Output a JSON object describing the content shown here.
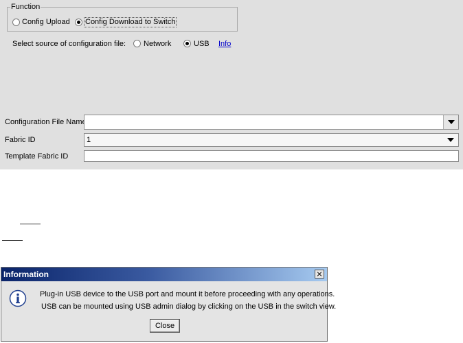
{
  "function_group": {
    "legend": "Function",
    "options": [
      {
        "label": "Config Upload",
        "selected": false
      },
      {
        "label": "Config Download to Switch",
        "selected": true
      }
    ]
  },
  "source": {
    "label": "Select source of configuration file:",
    "options": [
      {
        "label": "Network",
        "selected": false
      },
      {
        "label": "USB",
        "selected": true
      }
    ],
    "info_link": "Info"
  },
  "form": {
    "config_file_name": {
      "label": "Configuration File Name",
      "value": ""
    },
    "fabric_id": {
      "label": "Fabric ID",
      "value": "1"
    },
    "template_fabric_id": {
      "label": "Template Fabric ID",
      "value": ""
    }
  },
  "dialog": {
    "title": "Information",
    "icon": "info-icon",
    "line1": "Plug-in USB device to the USB port and mount it before proceeding with any operations.",
    "line2": "USB can be mounted using USB admin dialog by clicking on the USB in the switch view.",
    "close_label": "Close"
  },
  "colors": {
    "panel_bg": "#e0e0e0",
    "title_gradient_start": "#0a246a",
    "title_gradient_end": "#a6caf0",
    "link": "#0000cc"
  }
}
